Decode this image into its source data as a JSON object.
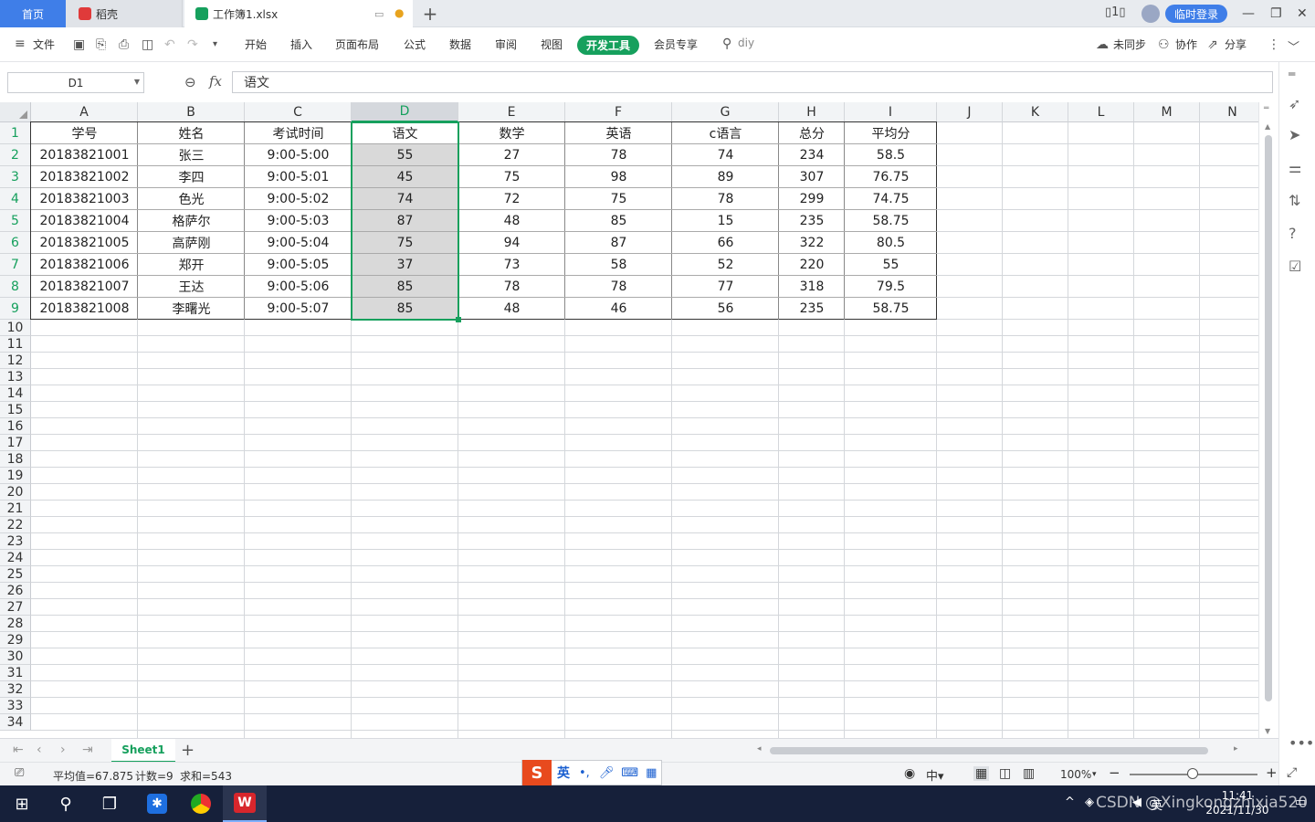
{
  "tabs": {
    "home": "首页",
    "daoke": "稻壳",
    "file": "工作簿1.xlsx",
    "add": "+"
  },
  "window": {
    "login": "临时登录",
    "min": "—",
    "max": "❐",
    "close": "✕"
  },
  "menu": {
    "file": "文件",
    "items": [
      "开始",
      "插入",
      "页面布局",
      "公式",
      "数据",
      "审阅",
      "视图"
    ],
    "dev": "开发工具",
    "member": "会员专享",
    "search": "diy",
    "sync": "未同步",
    "collab": "协作",
    "share": "分享"
  },
  "formula": {
    "cell_ref": "D1",
    "fx": "fx",
    "value": "语文"
  },
  "sheet": {
    "columns": [
      "A",
      "B",
      "C",
      "D",
      "E",
      "F",
      "G",
      "H",
      "I",
      "J",
      "K",
      "L",
      "M",
      "N"
    ],
    "row_numbers": [
      "1",
      "2",
      "3",
      "4",
      "5",
      "6",
      "7",
      "8",
      "9",
      "10",
      "11",
      "12",
      "13",
      "14",
      "15",
      "16",
      "17",
      "18",
      "19",
      "20",
      "21",
      "22",
      "23",
      "24",
      "25",
      "26",
      "27",
      "28",
      "29",
      "30",
      "31",
      "32",
      "33",
      "34"
    ],
    "header": [
      "学号",
      "姓名",
      "考试时间",
      "语文",
      "数学",
      "英语",
      "c语言",
      "总分",
      "平均分"
    ],
    "rows": [
      [
        "20183821001",
        "张三",
        "9:00-5:00",
        "55",
        "27",
        "78",
        "74",
        "234",
        "58.5"
      ],
      [
        "20183821002",
        "李四",
        "9:00-5:01",
        "45",
        "75",
        "98",
        "89",
        "307",
        "76.75"
      ],
      [
        "20183821003",
        "色光",
        "9:00-5:02",
        "74",
        "72",
        "75",
        "78",
        "299",
        "74.75"
      ],
      [
        "20183821004",
        "格萨尔",
        "9:00-5:03",
        "87",
        "48",
        "85",
        "15",
        "235",
        "58.75"
      ],
      [
        "20183821005",
        "高萨刚",
        "9:00-5:04",
        "75",
        "94",
        "87",
        "66",
        "322",
        "80.5"
      ],
      [
        "20183821006",
        "郑开",
        "9:00-5:05",
        "37",
        "73",
        "58",
        "52",
        "220",
        "55"
      ],
      [
        "20183821007",
        "王达",
        "9:00-5:06",
        "85",
        "78",
        "78",
        "77",
        "318",
        "79.5"
      ],
      [
        "20183821008",
        "李曙光",
        "9:00-5:07",
        "85",
        "48",
        "46",
        "56",
        "235",
        "58.75"
      ]
    ]
  },
  "sheettabs": {
    "sheet1": "Sheet1",
    "add": "+"
  },
  "status": {
    "avg": "平均值=67.875",
    "count": "计数=9",
    "sum": "求和=543",
    "zoom": "100%",
    "ime_lang": "英"
  },
  "taskbar": {
    "time": "11:41",
    "date": "2021/11/30",
    "lang": "英",
    "watermark": "CSDN @Xingkongzhixia520"
  }
}
